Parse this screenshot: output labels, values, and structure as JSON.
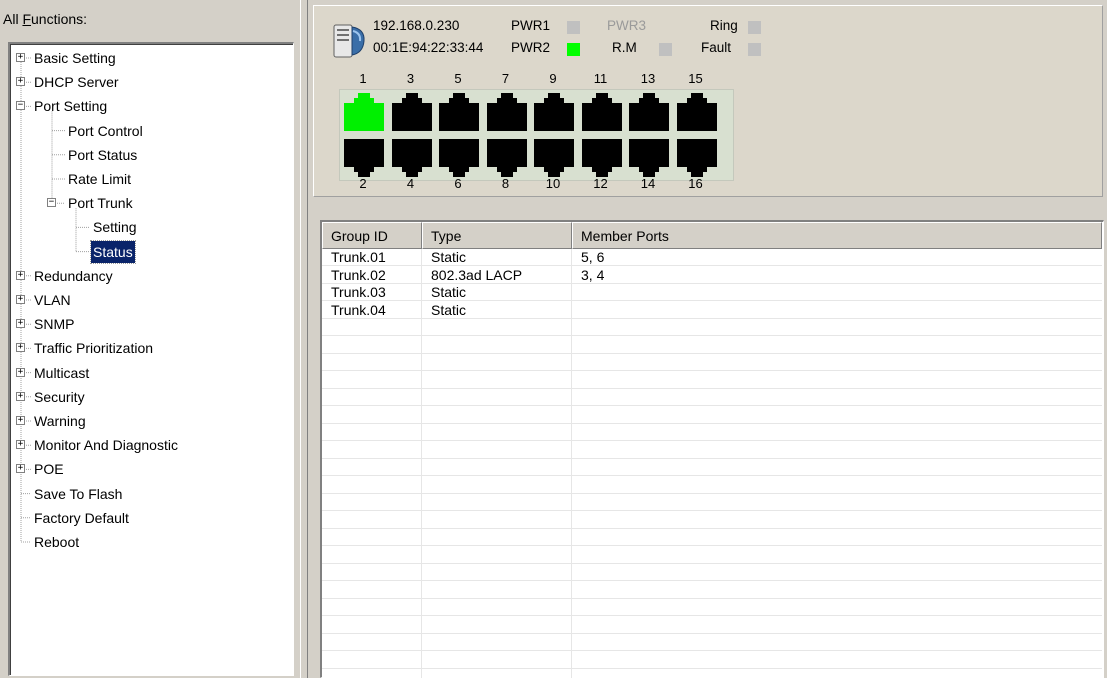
{
  "sidebar": {
    "label_prefix": "All ",
    "label_accel": "F",
    "label_rest": "unctions:",
    "items": [
      {
        "label": "Basic Setting",
        "expander": "+"
      },
      {
        "label": "DHCP Server",
        "expander": "+"
      },
      {
        "label": "Port Setting",
        "expander": "-"
      },
      {
        "label": "Port Control"
      },
      {
        "label": "Port Status"
      },
      {
        "label": "Rate Limit"
      },
      {
        "label": "Port Trunk",
        "expander": "-"
      },
      {
        "label": "Setting"
      },
      {
        "label": "Status",
        "selected": true
      },
      {
        "label": "Redundancy",
        "expander": "+"
      },
      {
        "label": "VLAN",
        "expander": "+"
      },
      {
        "label": "SNMP",
        "expander": "+"
      },
      {
        "label": "Traffic Prioritization",
        "expander": "+"
      },
      {
        "label": "Multicast",
        "expander": "+"
      },
      {
        "label": "Security",
        "expander": "+"
      },
      {
        "label": "Warning",
        "expander": "+"
      },
      {
        "label": "Monitor And Diagnostic",
        "expander": "+"
      },
      {
        "label": "POE",
        "expander": "+"
      },
      {
        "label": "Save To Flash"
      },
      {
        "label": "Factory Default"
      },
      {
        "label": "Reboot"
      }
    ]
  },
  "device": {
    "ip": "192.168.0.230",
    "mac": "00:1E:94:22:33:44",
    "indicators": {
      "pwr1": {
        "label": "PWR1",
        "state": "off"
      },
      "pwr2": {
        "label": "PWR2",
        "state": "on"
      },
      "pwr3": {
        "label": "PWR3",
        "state": "disabled"
      },
      "rm": {
        "label": "R.M",
        "state": "off"
      },
      "ring": {
        "label": "Ring",
        "state": "off"
      },
      "fault": {
        "label": "Fault",
        "state": "off"
      }
    },
    "colors": {
      "led_on": "#00ff00",
      "led_off": "#c0c0c0",
      "port_link": "#00f000",
      "port_idle": "#000000"
    },
    "top_ports": [
      "1",
      "3",
      "5",
      "7",
      "9",
      "11",
      "13",
      "15"
    ],
    "bottom_ports": [
      "2",
      "4",
      "6",
      "8",
      "10",
      "12",
      "14",
      "16"
    ],
    "link_up_ports": [
      "1"
    ]
  },
  "table": {
    "columns": [
      "Group ID",
      "Type",
      "Member Ports"
    ],
    "rows": [
      [
        "Trunk.01",
        "Static",
        "5, 6"
      ],
      [
        "Trunk.02",
        "802.3ad LACP",
        "3, 4"
      ],
      [
        "Trunk.03",
        "Static",
        ""
      ],
      [
        "Trunk.04",
        "Static",
        ""
      ]
    ]
  }
}
